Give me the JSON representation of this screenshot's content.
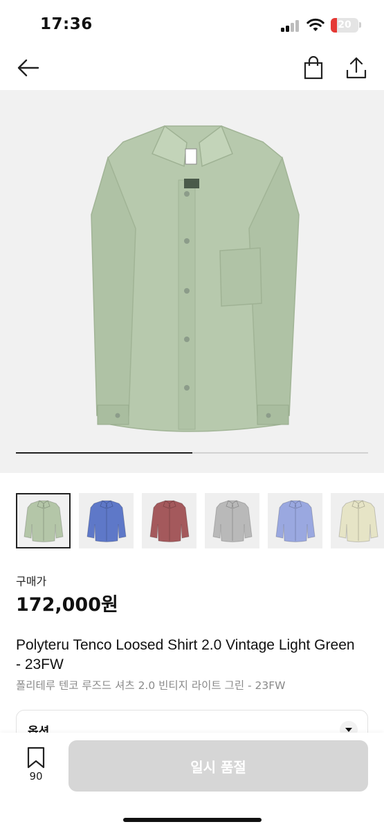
{
  "status_bar": {
    "time": "17:36",
    "battery_level": "20",
    "battery_color": "#e53935"
  },
  "nav": {
    "back_icon": "arrow-left-icon",
    "cart_icon": "shopping-bag-icon",
    "share_icon": "share-icon"
  },
  "gallery": {
    "main_color": "#b7c9ad",
    "progress": 0.5,
    "thumbnails": [
      {
        "color": "#b4c6a8",
        "selected": true
      },
      {
        "color": "#5e78c8",
        "selected": false
      },
      {
        "color": "#a4595c",
        "selected": false
      },
      {
        "color": "#b9b9b9",
        "selected": false
      },
      {
        "color": "#9aa8e0",
        "selected": false
      },
      {
        "color": "#e6e4c6",
        "selected": false
      }
    ]
  },
  "product": {
    "price_label": "구매가",
    "price": "172,000원",
    "title_en": "Polyteru Tenco Loosed Shirt 2.0 Vintage Light Green - 23FW",
    "title_ko": "폴리테루 텐코 루즈드 셔츠 2.0 빈티지 라이트 그린 - 23FW"
  },
  "option": {
    "label": "옵션"
  },
  "bottom_bar": {
    "bookmark_count": "90",
    "cta_label": "일시 품절",
    "cta_color": "#d6d6d6"
  }
}
